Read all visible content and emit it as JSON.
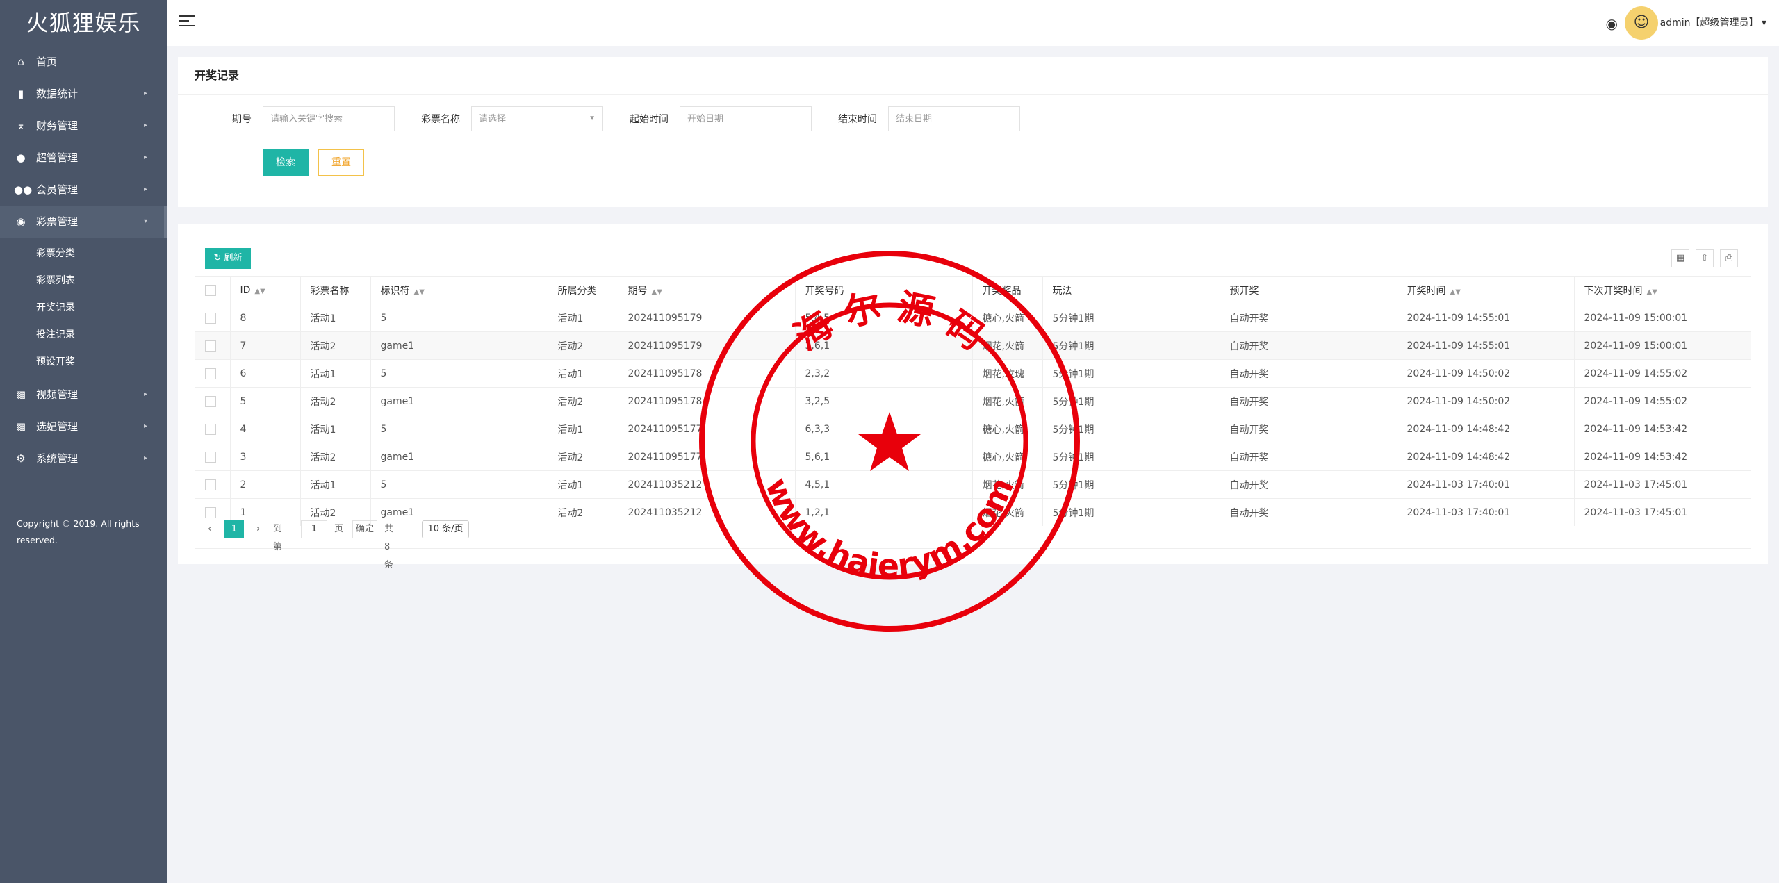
{
  "app": {
    "logo": "火狐狸娱乐",
    "copyright": "Copyright © 2019. All rights reserved."
  },
  "sidebar": {
    "items": [
      {
        "label": "首页",
        "icon": "home-icon",
        "has_children": false
      },
      {
        "label": "数据统计",
        "icon": "bar-chart-icon",
        "has_children": true
      },
      {
        "label": "财务管理",
        "icon": "bank-icon",
        "has_children": true
      },
      {
        "label": "超管管理",
        "icon": "user-icon",
        "has_children": true
      },
      {
        "label": "会员管理",
        "icon": "users-icon",
        "has_children": true
      },
      {
        "label": "彩票管理",
        "icon": "gamepad-icon",
        "has_children": true,
        "expanded": true
      },
      {
        "label": "视频管理",
        "icon": "video-icon",
        "has_children": true
      },
      {
        "label": "选妃管理",
        "icon": "video-icon",
        "has_children": true
      },
      {
        "label": "系统管理",
        "icon": "gear-icon",
        "has_children": true
      }
    ],
    "lottery_children": [
      "彩票分类",
      "彩票列表",
      "开奖记录",
      "投注记录",
      "预设开奖"
    ]
  },
  "header": {
    "user": "admin【超级管理员】",
    "user_caret": "▾"
  },
  "search": {
    "title": "开奖记录",
    "period_label": "期号",
    "period_placeholder": "请输入关键字搜索",
    "lottery_label": "彩票名称",
    "lottery_placeholder": "请选择",
    "start_label": "起始时间",
    "start_placeholder": "开始日期",
    "end_label": "结束时间",
    "end_placeholder": "结束日期",
    "search_button": "检索",
    "reset_button": "重置"
  },
  "table": {
    "refresh_button": "刷新",
    "columns": [
      "ID",
      "彩票名称",
      "标识符",
      "所属分类",
      "期号",
      "开奖号码",
      "开奖奖品",
      "玩法",
      "预开奖",
      "开奖时间",
      "下次开奖时间"
    ],
    "rows": [
      [
        "8",
        "活动1",
        "5",
        "活动1",
        "202411095179",
        "5,4,5",
        "糖心,火箭",
        "5分钟1期",
        "自动开奖",
        "2024-11-09 14:55:01",
        "2024-11-09 15:00:01"
      ],
      [
        "7",
        "活动2",
        "game1",
        "活动2",
        "202411095179",
        "3,6,1",
        "烟花,火箭",
        "5分钟1期",
        "自动开奖",
        "2024-11-09 14:55:01",
        "2024-11-09 15:00:01"
      ],
      [
        "6",
        "活动1",
        "5",
        "活动1",
        "202411095178",
        "2,3,2",
        "烟花,玫瑰",
        "5分钟1期",
        "自动开奖",
        "2024-11-09 14:50:02",
        "2024-11-09 14:55:02"
      ],
      [
        "5",
        "活动2",
        "game1",
        "活动2",
        "202411095178",
        "3,2,5",
        "烟花,火箭",
        "5分钟1期",
        "自动开奖",
        "2024-11-09 14:50:02",
        "2024-11-09 14:55:02"
      ],
      [
        "4",
        "活动1",
        "5",
        "活动1",
        "202411095177",
        "6,3,3",
        "糖心,火箭",
        "5分钟1期",
        "自动开奖",
        "2024-11-09 14:48:42",
        "2024-11-09 14:53:42"
      ],
      [
        "3",
        "活动2",
        "game1",
        "活动2",
        "202411095177",
        "5,6,1",
        "糖心,火箭",
        "5分钟1期",
        "自动开奖",
        "2024-11-09 14:48:42",
        "2024-11-09 14:53:42"
      ],
      [
        "2",
        "活动1",
        "5",
        "活动1",
        "202411035212",
        "4,5,1",
        "烟花,火箭",
        "5分钟1期",
        "自动开奖",
        "2024-11-03 17:40:01",
        "2024-11-03 17:45:01"
      ],
      [
        "1",
        "活动2",
        "game1",
        "活动2",
        "202411035212",
        "1,2,1",
        "烟花,火箭",
        "5分钟1期",
        "自动开奖",
        "2024-11-03 17:40:01",
        "2024-11-03 17:45:01"
      ]
    ]
  },
  "pager": {
    "prev": "‹",
    "current": "1",
    "next": "›",
    "goto_label": "到第",
    "goto_value": "1",
    "page_unit": "页",
    "confirm": "确定",
    "total": "共 8 条",
    "page_size": "10 条/页"
  },
  "watermark": {
    "top_text": "海 尔 源 码",
    "bottom_text": "www.haierym.com",
    "color": "#e8000b"
  },
  "colors": {
    "primary": "#1fb5a6",
    "warning": "#f0a020",
    "sidebar": "#4a5568"
  }
}
